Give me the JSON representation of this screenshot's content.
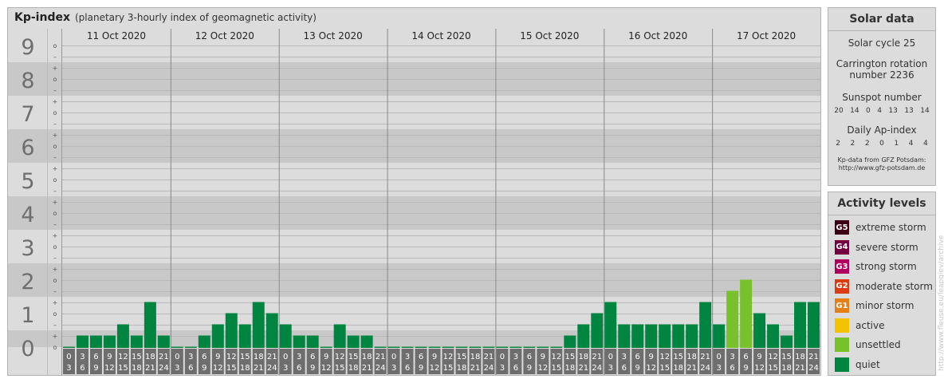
{
  "header": {
    "title": "Kp-index",
    "subtitle": "(planetary 3-hourly index of geomagnetic activity)"
  },
  "chart_data": {
    "type": "bar",
    "title": "Kp-index",
    "subtitle": "(planetary 3-hourly index of geomagnetic activity)",
    "ylim": [
      0,
      9
    ],
    "y_ticks": [
      "0",
      "1",
      "2",
      "3",
      "4",
      "5",
      "6",
      "7",
      "8",
      "9"
    ],
    "y_minor_ticks": [
      "o",
      "+",
      "–",
      "o",
      "+",
      "–",
      "o",
      "+",
      "–",
      "o",
      "+",
      "–",
      "o",
      "+",
      "–",
      "o",
      "+",
      "–",
      "o",
      "+",
      "–",
      "o",
      "+",
      "–",
      "o",
      "+",
      "–",
      "o"
    ],
    "days": [
      "11 Oct 2020",
      "12 Oct 2020",
      "13 Oct 2020",
      "14 Oct 2020",
      "15 Oct 2020",
      "16 Oct 2020",
      "17 Oct 2020"
    ],
    "interval_start_labels": [
      "0",
      "3",
      "6",
      "9",
      "12",
      "15",
      "18",
      "21"
    ],
    "interval_end_labels": [
      "3",
      "6",
      "9",
      "12",
      "15",
      "18",
      "21",
      "24"
    ],
    "values": [
      [
        0,
        0.333,
        0.333,
        0.333,
        0.667,
        0.333,
        1.333,
        0.333
      ],
      [
        0,
        0,
        0.333,
        0.667,
        1,
        0.667,
        1.333,
        1
      ],
      [
        0.667,
        0.333,
        0.333,
        0,
        0.667,
        0.333,
        0.333,
        0
      ],
      [
        0,
        0,
        0,
        0,
        0,
        0,
        0,
        0
      ],
      [
        0,
        0,
        0,
        0,
        0,
        0.333,
        0.667,
        1
      ],
      [
        1.333,
        0.667,
        0.667,
        0.667,
        0.667,
        0.667,
        0.667,
        1.333
      ],
      [
        0.667,
        1.667,
        2,
        1,
        0.667,
        0.333,
        1.333,
        1.333
      ]
    ],
    "bar_colors": {
      "quiet": "#008540",
      "unsettled": "#77c22b"
    },
    "band_colors": [
      "#c8c8c8",
      "#dcdcdc"
    ]
  },
  "solar_data": {
    "title": "Solar data",
    "cycle_label": "Solar cycle 25",
    "carrington_line1": "Carrington rotation",
    "carrington_line2": "number 2236",
    "sunspot_label": "Sunspot number",
    "sunspot_values": [
      "20",
      "14",
      "0",
      "4",
      "13",
      "13",
      "14"
    ],
    "ap_label": "Daily Ap-index",
    "ap_values": [
      "2",
      "2",
      "2",
      "0",
      "1",
      "4",
      "4"
    ],
    "source_line1": "Kp-data from GFZ Potsdam:",
    "source_line2": "http://www.gfz-potsdam.de"
  },
  "activity_levels": {
    "title": "Activity levels",
    "items": [
      {
        "code": "G5",
        "label": "extreme storm",
        "color": "#3d0013"
      },
      {
        "code": "G4",
        "label": "severe storm",
        "color": "#75003f"
      },
      {
        "code": "G3",
        "label": "strong storm",
        "color": "#b0005f"
      },
      {
        "code": "G2",
        "label": "moderate storm",
        "color": "#dc3c14"
      },
      {
        "code": "G1",
        "label": "minor storm",
        "color": "#e57f17"
      },
      {
        "code": "",
        "label": "active",
        "color": "#f3c300"
      },
      {
        "code": "",
        "label": "unsettled",
        "color": "#77c22b"
      },
      {
        "code": "",
        "label": "quiet",
        "color": "#008540"
      }
    ]
  },
  "watermark": "http://www.fleuse.eu/leapgiev/archive"
}
